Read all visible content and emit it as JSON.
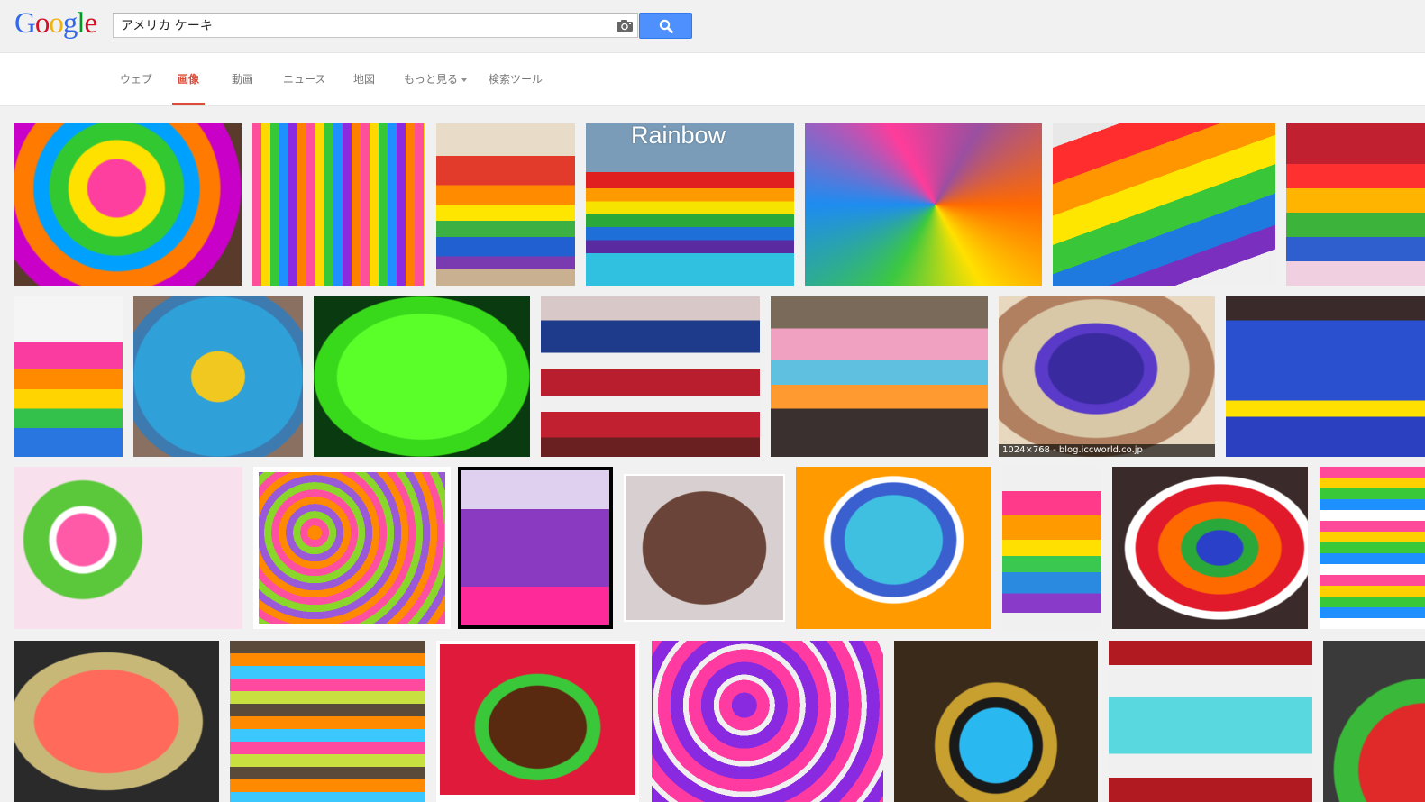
{
  "logo": {
    "letters": [
      "G",
      "o",
      "o",
      "g",
      "l",
      "e"
    ],
    "colors": [
      "#3369e8",
      "#d50f25",
      "#eeb211",
      "#3369e8",
      "#009925",
      "#d50f25"
    ]
  },
  "search": {
    "query": "アメリカ ケーキ",
    "camera_icon": "camera-icon",
    "button_icon": "search-icon"
  },
  "tabs": [
    {
      "label": "ウェブ"
    },
    {
      "label": "画像"
    },
    {
      "label": "動画"
    },
    {
      "label": "ニュース"
    },
    {
      "label": "地図"
    },
    {
      "label": "もっと見る"
    },
    {
      "label": "検索ツール"
    }
  ],
  "results": {
    "hover_caption": "1024×768 - blog.iccworld.co.jp",
    "rainbow_overlay": "Rainbow"
  },
  "colors": {
    "accent_red": "#dd4b39",
    "search_blue": "#4d90fe"
  }
}
